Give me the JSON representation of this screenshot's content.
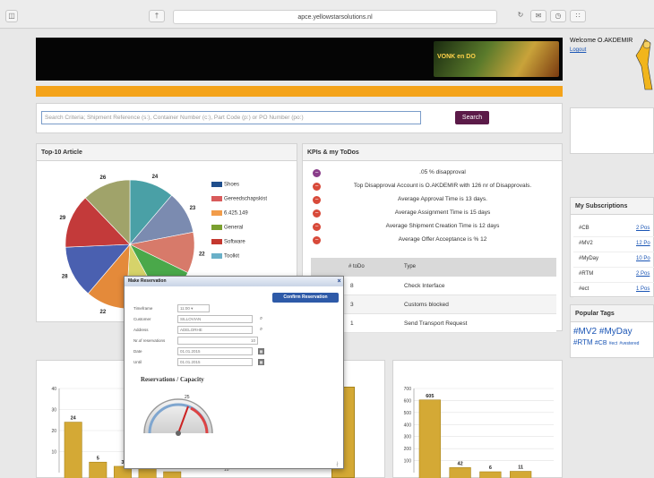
{
  "browser": {
    "url": "apce.yellowstarsolutions.nl"
  },
  "banner": {
    "ad_text": "VONK en DO"
  },
  "user": {
    "welcome": "Welcome O.AKDEMIR",
    "logout": "Logout"
  },
  "search": {
    "placeholder": "Search Criteria; Shipment Reference (s:), Container Number (c:), Part Code (p:) or PO Number (po:)",
    "button_label": "Search"
  },
  "top10": {
    "title": "Top-10 Article",
    "legend": [
      "Shoes",
      "Gereedschapskist",
      "6.425.149",
      "General",
      "Software",
      "Toolkit"
    ]
  },
  "kpis": {
    "title": "KPIs & my ToDos",
    "items": [
      ".05 % disapproval",
      "Top Disapproval Account is O.AKDEMIR with 126 nr of Disapprovals.",
      "Average Approval Time is 13 days.",
      "Average Assignment Time is 15 days",
      "Average Shipment Creation Time is 12 days",
      "Average Offer Acceptance is % 12"
    ],
    "todo_headers": [
      "# toDo",
      "Type"
    ],
    "todos": [
      {
        "count": "8",
        "type": "Check Interface"
      },
      {
        "count": "3",
        "type": "Customs blocked"
      },
      {
        "count": "1",
        "type": "Send Transport Request"
      }
    ]
  },
  "subscriptions": {
    "title": "My Subscriptions",
    "rows": [
      {
        "tag": "#CB",
        "link": "2 Pos"
      },
      {
        "tag": "#MV2",
        "link": "12 Po"
      },
      {
        "tag": "#MyDay",
        "link": "10 Po"
      },
      {
        "tag": "#RTM",
        "link": "2 Pos"
      },
      {
        "tag": "#ect",
        "link": "1 Pos"
      }
    ]
  },
  "popular_tags": {
    "title": "Popular Tags",
    "line1": [
      "#MV2",
      "#MyDay"
    ],
    "line2": [
      "#RTM",
      "#CB",
      "#ect",
      "#vestered"
    ]
  },
  "modal": {
    "title": "Make Reservation",
    "confirm_label": "Confirm Reservation",
    "fields": [
      {
        "label": "Timeframe",
        "value": "11:00"
      },
      {
        "label": "Customer",
        "value": "SILLOVIAN"
      },
      {
        "label": "Address",
        "value": "ADELORHE"
      },
      {
        "label": "Nr.of reservations",
        "value": "10"
      },
      {
        "label": "Date",
        "value": "01.01.2015"
      },
      {
        "label": "Until",
        "value": "01.01.2015"
      }
    ],
    "chart_title": "Reservations / Capacity",
    "gauge_value": "25"
  },
  "chart_data": [
    {
      "type": "pie",
      "title": "Top-10 Article",
      "values": [
        24,
        23,
        22,
        21,
        19,
        22,
        28,
        29,
        26
      ],
      "labels": [
        "24",
        "23",
        "22",
        "21",
        "19",
        "22",
        "28",
        "29",
        "26"
      ],
      "colors": [
        "#4aa0a6",
        "#7b8bb0",
        "#d77a6a",
        "#4aa84a",
        "#d6d36a",
        "#e48a3a",
        "#4a60b0",
        "#c33a3a",
        "#a0a36a"
      ],
      "legend": [
        "Shoes",
        "Gereedschapskist",
        "6.425.149",
        "General",
        "Software",
        "Toolkit"
      ]
    },
    {
      "type": "bar",
      "values": [
        24,
        5,
        3,
        5,
        0
      ],
      "labels": [
        "24",
        "5",
        "3",
        "5",
        "0"
      ],
      "yticks": [
        "40",
        "30",
        "20",
        "10"
      ],
      "ylim": [
        0,
        40
      ]
    },
    {
      "type": "bar",
      "values": [
        605,
        42,
        6,
        11
      ],
      "labels": [
        "605",
        "42",
        "6",
        "11"
      ],
      "yticks": [
        "700",
        "600",
        "500",
        "400",
        "300",
        "200",
        "100"
      ],
      "ylim": [
        0,
        700
      ]
    }
  ]
}
